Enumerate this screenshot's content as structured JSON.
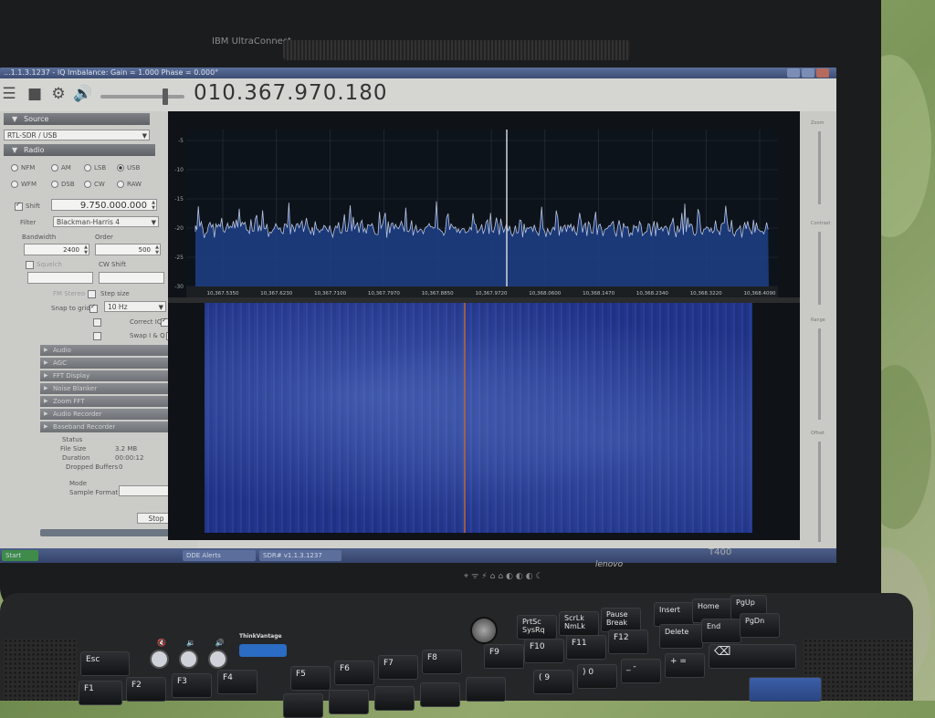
{
  "window": {
    "title": "...1.1.3.1237 - IQ Imbalance: Gain = 1.000 Phase = 0.000°"
  },
  "toolbar": {
    "frequency": "010.367.970.180",
    "icons": [
      "menu-icon",
      "stop-icon",
      "gear-icon",
      "speaker-icon"
    ]
  },
  "source": {
    "header": "Source",
    "device": "RTL-SDR / USB"
  },
  "radio": {
    "header": "Radio",
    "modes_row1": [
      "NFM",
      "AM",
      "LSB",
      "USB"
    ],
    "modes_row2": [
      "WFM",
      "DSB",
      "CW",
      "RAW"
    ],
    "selected_mode": "USB",
    "shift_label": "Shift",
    "shift_value": "9.750.000.000",
    "filter_label": "Filter",
    "filter_value": "Blackman-Harris 4",
    "bandwidth_label": "Bandwidth",
    "bandwidth_value": "2400",
    "order_label": "Order",
    "order_value": "500",
    "squelch_label": "Squelch",
    "cw_shift_label": "CW Shift",
    "step_size_label": "Step size",
    "snap_label": "Snap to grid",
    "snap_value": "10 Hz",
    "correct_iq_label": "Correct IQ",
    "swap_iq_label": "Swap I & Q",
    "fm_stereo_label": "FM Stereo"
  },
  "collapsed_sections": [
    "Audio",
    "AGC",
    "FFT Display",
    "Noise Blanker",
    "Zoom FFT",
    "Audio Recorder",
    "Baseband Recorder"
  ],
  "recorder": {
    "status_label": "Status",
    "file_size_label": "File Size",
    "file_size_value": "3.2 MB",
    "duration_label": "Duration",
    "duration_value": "00:00:12",
    "dropped_label": "Dropped Buffers",
    "dropped_value": "0",
    "mode_label": "Mode",
    "format_label": "Sample Format",
    "record_label": "Stop"
  },
  "spectrum": {
    "y_ticks": [
      "-5",
      "-10",
      "-15",
      "-20",
      "-25",
      "-30"
    ],
    "x_ticks": [
      "10,367.5350",
      "10,367.6230",
      "10,367.7100",
      "10,367.7970",
      "10,367.8850",
      "10,367.9720",
      "10,368.0600",
      "10,368.1470",
      "10,368.2340",
      "10,368.3220",
      "10,368.4090"
    ]
  },
  "right_strip": {
    "labels": [
      "Zoom",
      "Contrast",
      "Range",
      "Offset"
    ]
  },
  "taskbar": {
    "items": [
      "Start",
      "DDE Alerts",
      "SDR# v1.1.3.1237"
    ]
  },
  "laptop": {
    "brand": "lenovo",
    "model": "T400",
    "top_logo": "IBM UltraConnect",
    "thinkvantage": "ThinkVantage"
  },
  "keyboard": {
    "row_fn": [
      {
        "label": "Esc"
      },
      {
        "label": "F5"
      },
      {
        "label": "F6"
      },
      {
        "label": "F7"
      },
      {
        "label": "F8"
      },
      {
        "label": "F9"
      },
      {
        "label": "PrtSc\nSysRq"
      },
      {
        "label": "ScrLk\nNmLk"
      },
      {
        "label": "Pause\nBreak"
      },
      {
        "label": "Insert"
      },
      {
        "label": "Home"
      },
      {
        "label": "PgUp"
      }
    ],
    "row_2": [
      {
        "label": "F1"
      },
      {
        "label": "F2"
      },
      {
        "label": "F3"
      },
      {
        "label": "F4"
      },
      {
        "label": "F10"
      },
      {
        "label": "F11"
      },
      {
        "label": "F12"
      },
      {
        "label": "Delete"
      },
      {
        "label": "End"
      },
      {
        "label": "PgDn"
      }
    ],
    "row_3": [
      {
        "label": ""
      },
      {
        "label": ""
      },
      {
        "label": ""
      },
      {
        "label": ""
      },
      {
        "label": ""
      },
      {
        "label": "( 9"
      },
      {
        "label": ") 0"
      },
      {
        "label": "_ -"
      },
      {
        "label": "+ ="
      },
      {
        "label": "⌫"
      }
    ]
  }
}
